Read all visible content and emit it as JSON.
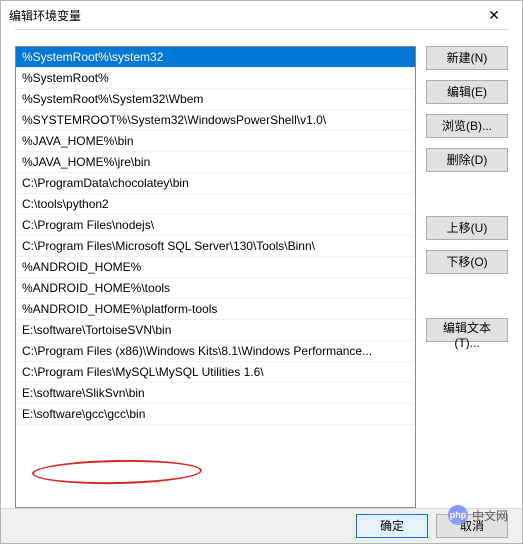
{
  "window": {
    "title": "编辑环境变量",
    "close_icon": "✕"
  },
  "list": {
    "items": [
      "%SystemRoot%\\system32",
      "%SystemRoot%",
      "%SystemRoot%\\System32\\Wbem",
      "%SYSTEMROOT%\\System32\\WindowsPowerShell\\v1.0\\",
      "%JAVA_HOME%\\bin",
      "%JAVA_HOME%\\jre\\bin",
      "C:\\ProgramData\\chocolatey\\bin",
      "C:\\tools\\python2",
      "C:\\Program Files\\nodejs\\",
      "C:\\Program Files\\Microsoft SQL Server\\130\\Tools\\Binn\\",
      "%ANDROID_HOME%",
      "%ANDROID_HOME%\\tools",
      "%ANDROID_HOME%\\platform-tools",
      "E:\\software\\TortoiseSVN\\bin",
      "C:\\Program Files (x86)\\Windows Kits\\8.1\\Windows Performance...",
      "C:\\Program Files\\MySQL\\MySQL Utilities 1.6\\",
      "E:\\software\\SlikSvn\\bin",
      "E:\\software\\gcc\\gcc\\bin"
    ],
    "selected_index": 0
  },
  "buttons": {
    "new": "新建(N)",
    "edit": "编辑(E)",
    "browse": "浏览(B)...",
    "delete": "删除(D)",
    "move_up": "上移(U)",
    "move_down": "下移(O)",
    "edit_text": "编辑文本(T)..."
  },
  "footer": {
    "ok": "确定",
    "cancel": "取消"
  },
  "watermark": {
    "logo_text": "php",
    "site_text": "中文网"
  }
}
